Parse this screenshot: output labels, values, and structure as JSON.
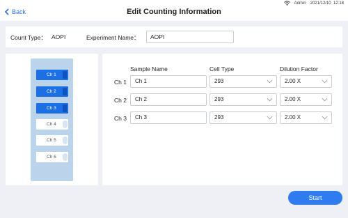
{
  "status": {
    "user": "Admin",
    "datetime": "2021/12/10  12:18",
    "wifi_icon": "wifi-icon"
  },
  "header": {
    "back_label": "Back",
    "title": "Edit Counting Information"
  },
  "info": {
    "count_type_label": "Count Type：",
    "count_type_value": "AOPI",
    "experiment_name_label": "Experiment Name：",
    "experiment_name_value": "AOPI"
  },
  "channels": [
    {
      "label": "Ch 1",
      "active": true
    },
    {
      "label": "Ch 2",
      "active": true
    },
    {
      "label": "Ch 3",
      "active": true
    },
    {
      "label": "Ch 4",
      "active": false
    },
    {
      "label": "Ch 5",
      "active": false
    },
    {
      "label": "Ch 6",
      "active": false
    }
  ],
  "table": {
    "headers": {
      "sample_name": "Sample Name",
      "cell_type": "Cell Type",
      "dilution_factor": "Dilution Factor"
    },
    "rows": [
      {
        "channel": "Ch 1",
        "sample_name": "Ch 1",
        "cell_type": "293",
        "dilution_factor": "2.00 X"
      },
      {
        "channel": "Ch 2",
        "sample_name": "Ch 2",
        "cell_type": "293",
        "dilution_factor": "2.00 X"
      },
      {
        "channel": "Ch 3",
        "sample_name": "Ch 3",
        "cell_type": "293",
        "dilution_factor": "2.00 X"
      }
    ]
  },
  "actions": {
    "start_label": "Start"
  },
  "colors": {
    "accent": "#2e7cf0",
    "chip_active": "#1d6fe6",
    "tray": "#bcd3ec",
    "background": "#eef0f5"
  }
}
